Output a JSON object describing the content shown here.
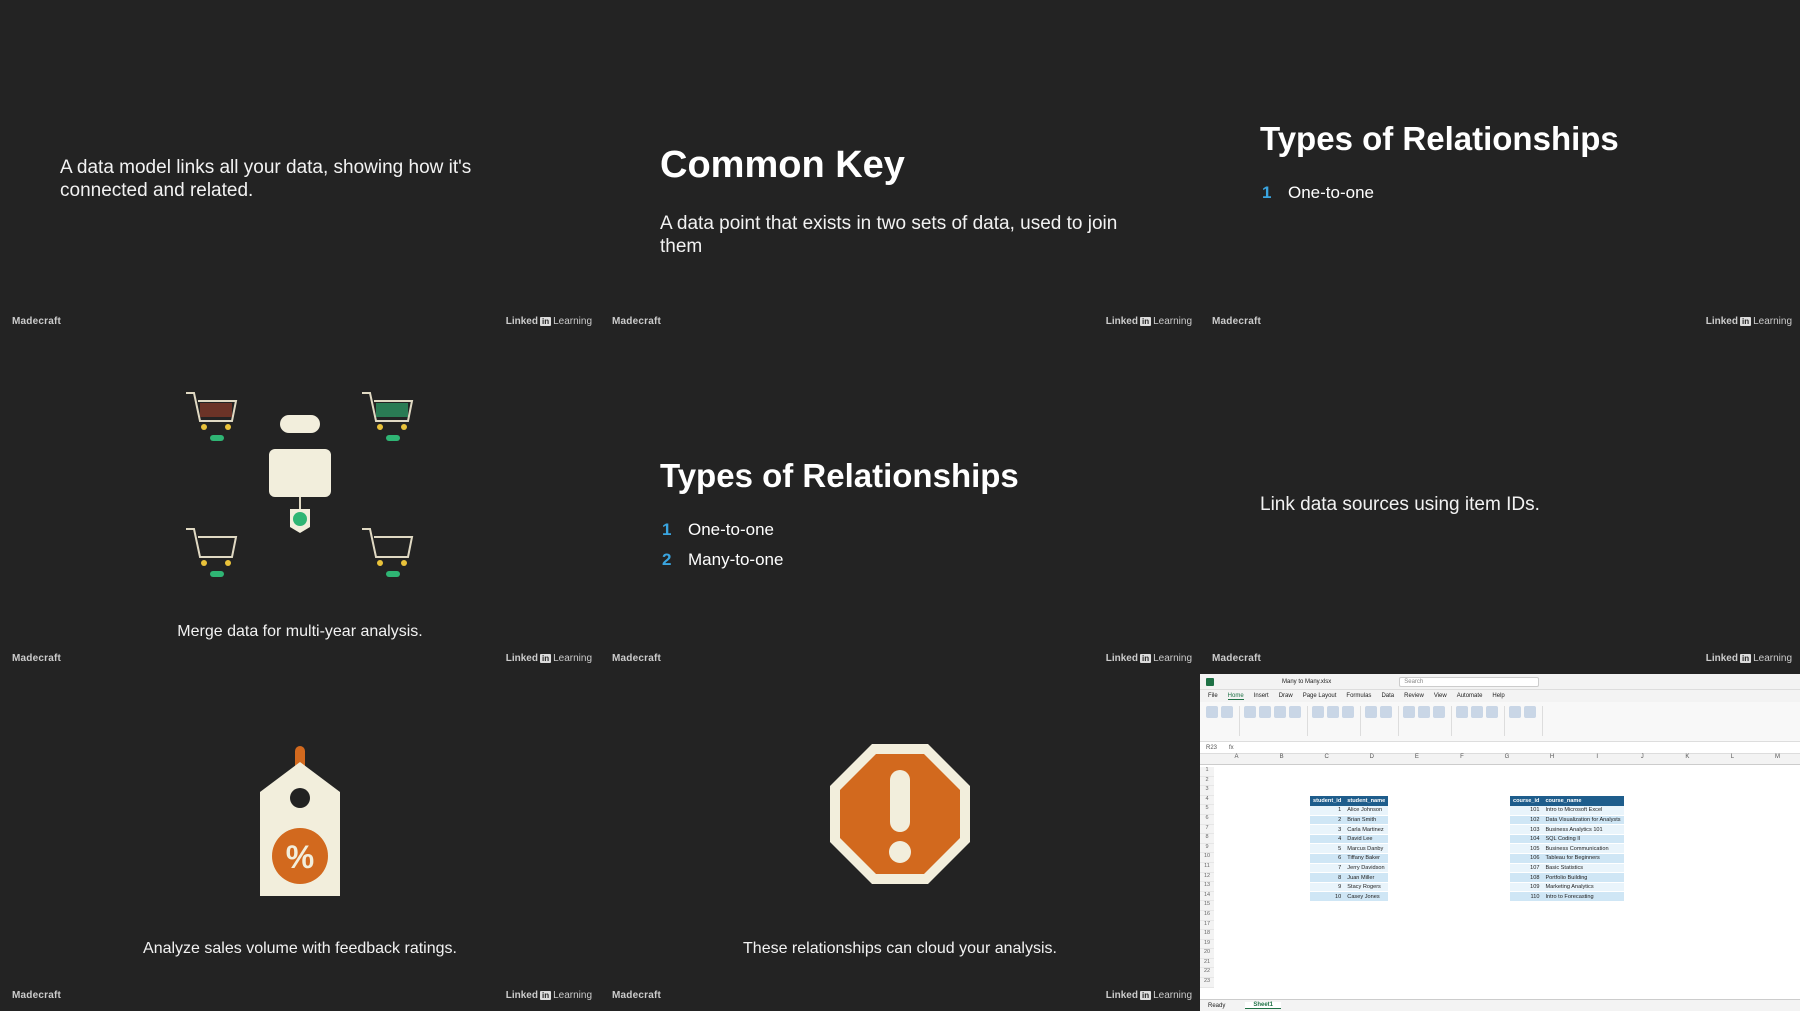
{
  "colors": {
    "accent": "#3aa5e0",
    "background": "#232323",
    "orange": "#d2691e",
    "green": "#2fb574",
    "excel_header": "#1e5d8c"
  },
  "branding": {
    "left": "Madecraft",
    "linkedin": "Linked",
    "in": "in",
    "learning": "Learning"
  },
  "tiles": {
    "data_model": {
      "text": "A data model links all your data, showing how it's connected and related."
    },
    "common_key": {
      "title": "Common Key",
      "text": "A data point that exists in two sets of data, used to join them"
    },
    "types_one": {
      "title": "Types of Relationships",
      "items": [
        {
          "num": "1",
          "label": "One-to-one"
        }
      ]
    },
    "merge": {
      "caption": "Merge data for multi-year analysis."
    },
    "types_two": {
      "title": "Types of Relationships",
      "items": [
        {
          "num": "1",
          "label": "One-to-one"
        },
        {
          "num": "2",
          "label": "Many-to-one"
        }
      ]
    },
    "link": {
      "text": "Link data sources using item IDs."
    },
    "analyze": {
      "caption": "Analyze sales volume with feedback ratings."
    },
    "cloud": {
      "caption": "These relationships can cloud your analysis."
    }
  },
  "excel": {
    "title": "Many to Many.xlsx",
    "search_placeholder": "Search",
    "menu": [
      "File",
      "Home",
      "Insert",
      "Draw",
      "Page Layout",
      "Formulas",
      "Data",
      "Review",
      "View",
      "Automate",
      "Help"
    ],
    "cell_ref": "R23",
    "columns": [
      "A",
      "B",
      "C",
      "D",
      "E",
      "F",
      "G",
      "H",
      "I",
      "J",
      "K",
      "L",
      "M"
    ],
    "rows": [
      "1",
      "2",
      "3",
      "4",
      "5",
      "6",
      "7",
      "8",
      "9",
      "10",
      "11",
      "12",
      "13",
      "14",
      "15",
      "16",
      "17",
      "18",
      "19",
      "20",
      "21",
      "22",
      "23"
    ],
    "students": {
      "headers": [
        "student_id",
        "student_name"
      ],
      "rows": [
        [
          "1",
          "Alice Johnson"
        ],
        [
          "2",
          "Brian Smith"
        ],
        [
          "3",
          "Carla Martinez"
        ],
        [
          "4",
          "David Lee"
        ],
        [
          "5",
          "Marcus Danby"
        ],
        [
          "6",
          "Tiffany Baker"
        ],
        [
          "7",
          "Jerry Davidson"
        ],
        [
          "8",
          "Juan Miller"
        ],
        [
          "9",
          "Stacy Rogers"
        ],
        [
          "10",
          "Casey Jones"
        ]
      ]
    },
    "courses": {
      "headers": [
        "course_id",
        "course_name"
      ],
      "rows": [
        [
          "101",
          "Intro to Microsoft Excel"
        ],
        [
          "102",
          "Data Visualization for Analysts"
        ],
        [
          "103",
          "Business Analytics 101"
        ],
        [
          "104",
          "SQL Coding II"
        ],
        [
          "105",
          "Business Communication"
        ],
        [
          "106",
          "Tableau for Beginners"
        ],
        [
          "107",
          "Basic Statistics"
        ],
        [
          "108",
          "Portfolio Building"
        ],
        [
          "109",
          "Marketing Analytics"
        ],
        [
          "110",
          "Intro to Forecasting"
        ]
      ]
    },
    "sheet_tab": "Sheet1",
    "status": "Ready"
  }
}
